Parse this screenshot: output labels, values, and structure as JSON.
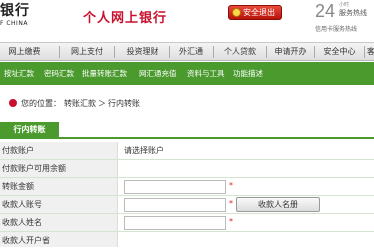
{
  "header": {
    "logo_text": "银行",
    "logo_sub": "F CHINA",
    "title": "个人网上银行",
    "logout_label": "安全退出",
    "hotline_number": "24",
    "hotline_hours": "小时",
    "hotline_label": "服务热线",
    "credit_hotline": "信用卡服务热线"
  },
  "nav": {
    "items": [
      "网上缴费",
      "网上支付",
      "投资理财",
      "外汇通",
      "个人贷款",
      "申请开办",
      "安全中心",
      "客"
    ]
  },
  "subnav": {
    "items": [
      "按址汇款",
      "密码汇款",
      "批量转账汇款",
      "网汇通充值",
      "资料与工具",
      "功能描述"
    ]
  },
  "breadcrumb": {
    "prefix": "您的位置：",
    "level1": "转账汇款",
    "separator": "＞",
    "level2": "行内转账"
  },
  "tab": {
    "label": "行内转账"
  },
  "form": {
    "rows": [
      {
        "label": "付款账户",
        "value": "请选择账户"
      },
      {
        "label": "付款账户可用余额",
        "value": ""
      },
      {
        "label": "转账金额",
        "required": "*"
      },
      {
        "label": "收款人账号",
        "required": "*",
        "button": "收款人名册"
      },
      {
        "label": "收款人姓名",
        "required": "*"
      },
      {
        "label": "收款人开户省"
      }
    ]
  },
  "colors": {
    "brand_red": "#c8102e",
    "nav_green": "#4a9a2e"
  },
  "icons": {
    "logout": "lock-icon",
    "breadcrumb": "location-icon"
  }
}
